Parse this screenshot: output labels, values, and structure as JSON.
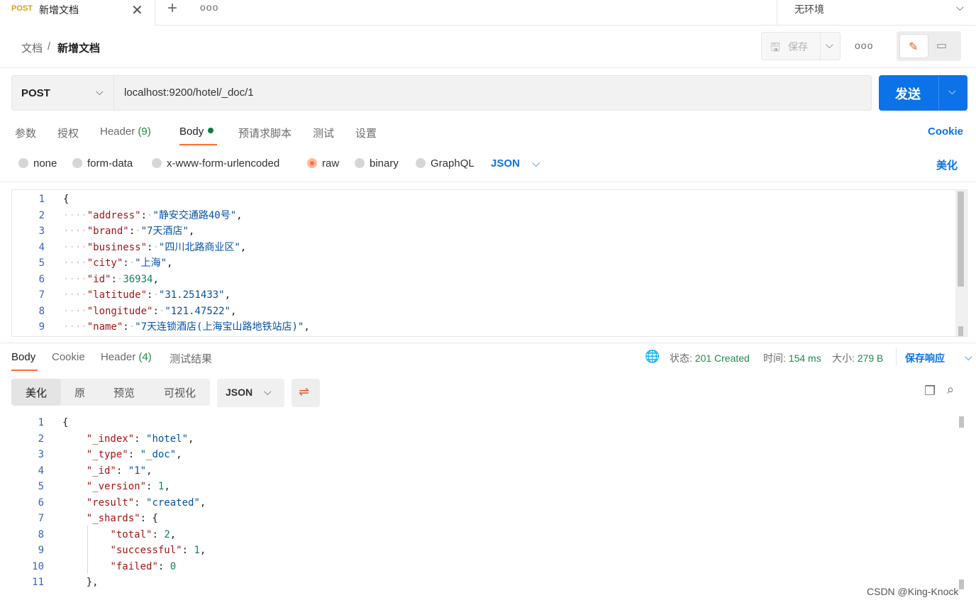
{
  "tab": {
    "method": "POST",
    "title": "新增文档",
    "close": "✕"
  },
  "tabstrip": {
    "add": "+",
    "more": "ooo"
  },
  "environment": {
    "label": "无环境"
  },
  "breadcrumb": {
    "parent": "文档",
    "separator": "/",
    "current": "新增文档"
  },
  "toolbar": {
    "save_label": "保存",
    "more": "ooo"
  },
  "request": {
    "method": "POST",
    "url": "localhost:9200/hotel/_doc/1",
    "send_label": "发送"
  },
  "request_tabs": {
    "params": "参数",
    "auth": "授权",
    "header_label": "Header",
    "header_count": "(9)",
    "body": "Body",
    "pre_script": "预请求脚本",
    "tests": "测试",
    "settings": "设置",
    "cookie": "Cookie"
  },
  "body_types": {
    "none": "none",
    "form_data": "form-data",
    "urlencoded": "x-www-form-urlencoded",
    "raw": "raw",
    "binary": "binary",
    "graphql": "GraphQL",
    "selected": "raw",
    "language": "JSON",
    "beautify": "美化"
  },
  "request_body": {
    "line_numbers": [
      "1",
      "2",
      "3",
      "4",
      "5",
      "6",
      "7",
      "8",
      "9"
    ],
    "lines": [
      [
        [
          "p",
          "{"
        ]
      ],
      [
        [
          "ws",
          "····"
        ],
        [
          "k",
          "\"address\""
        ],
        [
          "p",
          ":"
        ],
        [
          "ws",
          "·"
        ],
        [
          "s",
          "\"静安交通路40号\""
        ],
        [
          "p",
          ","
        ]
      ],
      [
        [
          "ws",
          "····"
        ],
        [
          "k",
          "\"brand\""
        ],
        [
          "p",
          ":"
        ],
        [
          "ws",
          "·"
        ],
        [
          "s",
          "\"7天酒店\""
        ],
        [
          "p",
          ","
        ]
      ],
      [
        [
          "ws",
          "····"
        ],
        [
          "k",
          "\"business\""
        ],
        [
          "p",
          ":"
        ],
        [
          "ws",
          "·"
        ],
        [
          "s",
          "\"四川北路商业区\""
        ],
        [
          "p",
          ","
        ]
      ],
      [
        [
          "ws",
          "····"
        ],
        [
          "k",
          "\"city\""
        ],
        [
          "p",
          ":"
        ],
        [
          "ws",
          "·"
        ],
        [
          "s",
          "\"上海\""
        ],
        [
          "p",
          ","
        ]
      ],
      [
        [
          "ws",
          "····"
        ],
        [
          "k",
          "\"id\""
        ],
        [
          "p",
          ":"
        ],
        [
          "ws",
          "·"
        ],
        [
          "n",
          "36934"
        ],
        [
          "p",
          ","
        ]
      ],
      [
        [
          "ws",
          "····"
        ],
        [
          "k",
          "\"latitude\""
        ],
        [
          "p",
          ":"
        ],
        [
          "ws",
          "·"
        ],
        [
          "s",
          "\"31.251433\""
        ],
        [
          "p",
          ","
        ]
      ],
      [
        [
          "ws",
          "····"
        ],
        [
          "k",
          "\"longitude\""
        ],
        [
          "p",
          ":"
        ],
        [
          "ws",
          "·"
        ],
        [
          "s",
          "\"121.47522\""
        ],
        [
          "p",
          ","
        ]
      ],
      [
        [
          "ws",
          "····"
        ],
        [
          "k",
          "\"name\""
        ],
        [
          "p",
          ":"
        ],
        [
          "ws",
          "·"
        ],
        [
          "s",
          "\"7天连锁酒店(上海宝山路地铁站店)\""
        ],
        [
          "p",
          ","
        ]
      ]
    ]
  },
  "response_tabs": {
    "body": "Body",
    "cookie": "Cookie",
    "header_label": "Header",
    "header_count": "(4)",
    "test_results": "测试结果"
  },
  "response_status": {
    "status_label": "状态:",
    "status_value": "201 Created",
    "time_label": "时间:",
    "time_value": "154 ms",
    "size_label": "大小:",
    "size_value": "279 B",
    "save_response": "保存响应"
  },
  "response_format": {
    "pretty": "美化",
    "raw": "原",
    "preview": "预览",
    "visualize": "可视化",
    "language": "JSON"
  },
  "response_body": {
    "line_numbers": [
      "1",
      "2",
      "3",
      "4",
      "5",
      "6",
      "7",
      "8",
      "9",
      "10",
      "11"
    ],
    "lines": [
      [
        [
          "p",
          "{"
        ]
      ],
      [
        [
          "p",
          "    "
        ],
        [
          "k",
          "\"_index\""
        ],
        [
          "p",
          ": "
        ],
        [
          "s",
          "\"hotel\""
        ],
        [
          "p",
          ","
        ]
      ],
      [
        [
          "p",
          "    "
        ],
        [
          "k",
          "\"_type\""
        ],
        [
          "p",
          ": "
        ],
        [
          "s",
          "\"_doc\""
        ],
        [
          "p",
          ","
        ]
      ],
      [
        [
          "p",
          "    "
        ],
        [
          "k",
          "\"_id\""
        ],
        [
          "p",
          ": "
        ],
        [
          "s",
          "\"1\""
        ],
        [
          "p",
          ","
        ]
      ],
      [
        [
          "p",
          "    "
        ],
        [
          "k",
          "\"_version\""
        ],
        [
          "p",
          ": "
        ],
        [
          "n",
          "1"
        ],
        [
          "p",
          ","
        ]
      ],
      [
        [
          "p",
          "    "
        ],
        [
          "k",
          "\"result\""
        ],
        [
          "p",
          ": "
        ],
        [
          "s",
          "\"created\""
        ],
        [
          "p",
          ","
        ]
      ],
      [
        [
          "p",
          "    "
        ],
        [
          "k",
          "\"_shards\""
        ],
        [
          "p",
          ": {"
        ]
      ],
      [
        [
          "p",
          "        "
        ],
        [
          "k",
          "\"total\""
        ],
        [
          "p",
          ": "
        ],
        [
          "n",
          "2"
        ],
        [
          "p",
          ","
        ]
      ],
      [
        [
          "p",
          "        "
        ],
        [
          "k",
          "\"successful\""
        ],
        [
          "p",
          ": "
        ],
        [
          "n",
          "1"
        ],
        [
          "p",
          ","
        ]
      ],
      [
        [
          "p",
          "        "
        ],
        [
          "k",
          "\"failed\""
        ],
        [
          "p",
          ": "
        ],
        [
          "n",
          "0"
        ]
      ],
      [
        [
          "p",
          "    },"
        ]
      ]
    ]
  },
  "watermark": "CSDN @King-Knock",
  "colors": {
    "accent": "#0b72e7",
    "active_tab": "#ff6c37",
    "status_green": "#1d8a4a",
    "method_post": "#d4a017"
  },
  "icons": [
    "close-icon",
    "plus-icon",
    "more-icon",
    "chevron-down-icon",
    "save-icon",
    "edit-icon",
    "comment-icon",
    "globe-icon",
    "wrap-icon",
    "copy-icon",
    "search-icon"
  ]
}
